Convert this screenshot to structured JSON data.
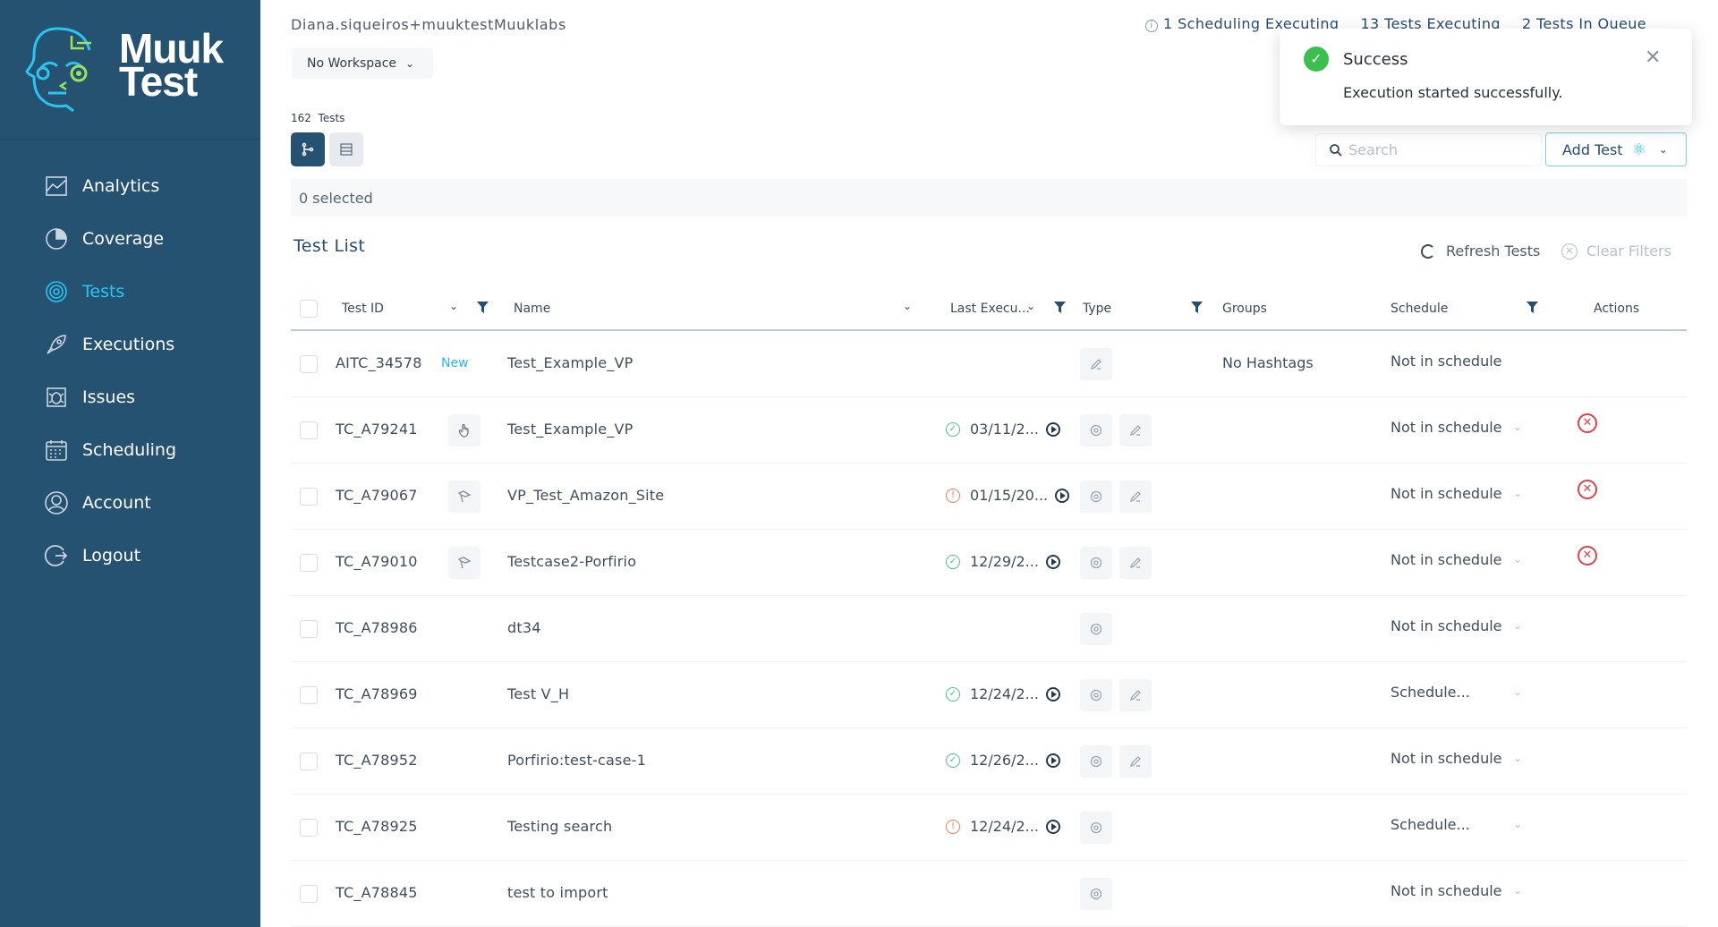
{
  "brand": {
    "line1": "Muuk",
    "line2": "Test"
  },
  "nav": [
    {
      "label": "Analytics",
      "icon": "analytics-icon"
    },
    {
      "label": "Coverage",
      "icon": "coverage-icon"
    },
    {
      "label": "Tests",
      "icon": "tests-icon",
      "active": true
    },
    {
      "label": "Executions",
      "icon": "rocket-icon"
    },
    {
      "label": "Issues",
      "icon": "bug-icon"
    },
    {
      "label": "Scheduling",
      "icon": "calendar-icon"
    },
    {
      "label": "Account",
      "icon": "user-icon"
    },
    {
      "label": "Logout",
      "icon": "logout-icon"
    }
  ],
  "header": {
    "user": "Diana.siqueiros+muuktestMuuklabs",
    "workspace": "No Workspace",
    "status": [
      "1 Scheduling Executing",
      "13 Tests Executing",
      "2 Tests In Queue"
    ]
  },
  "tests": {
    "count": "162",
    "count_label": "Tests",
    "selected": "0 selected"
  },
  "search": {
    "placeholder": "Search"
  },
  "add_test": "Add Test",
  "list": {
    "title": "Test List",
    "refresh": "Refresh Tests",
    "clear": "Clear Filters"
  },
  "columns": {
    "test_id": "Test ID",
    "name": "Name",
    "last_exec": "Last Execu...",
    "type": "Type",
    "groups": "Groups",
    "schedule": "Schedule",
    "actions": "Actions"
  },
  "rows": [
    {
      "id": "AITC_34578",
      "badge": "New",
      "name": "Test_Example_VP",
      "last_exec": "",
      "groups": "No Hashtags",
      "schedule": "Not in schedule"
    },
    {
      "id": "TC_A79241",
      "name": "Test_Example_VP",
      "last_exec": "03/11/2...",
      "status": "ok",
      "groups": "",
      "schedule": "Not in schedule"
    },
    {
      "id": "TC_A79067",
      "name": "VP_Test_Amazon_Site",
      "last_exec": "01/15/20...",
      "status": "warn",
      "groups": "",
      "schedule": "Not in schedule"
    },
    {
      "id": "TC_A79010",
      "name": "Testcase2-Porfirio",
      "last_exec": "12/29/2...",
      "status": "ok",
      "groups": "",
      "schedule": "Not in schedule"
    },
    {
      "id": "TC_A78986",
      "name": "dt34",
      "last_exec": "",
      "groups": "",
      "schedule": "Not in schedule"
    },
    {
      "id": "TC_A78969",
      "name": "Test V_H",
      "last_exec": "12/24/2...",
      "status": "ok",
      "groups": "",
      "schedule": "Schedule..."
    },
    {
      "id": "TC_A78952",
      "name": "Porfirio:test-case-1",
      "last_exec": "12/26/2...",
      "status": "ok",
      "groups": "",
      "schedule": "Not in schedule"
    },
    {
      "id": "TC_A78925",
      "name": "Testing search",
      "last_exec": "12/24/2...",
      "status": "warn",
      "groups": "",
      "schedule": "Schedule..."
    },
    {
      "id": "TC_A78845",
      "name": "test to import",
      "last_exec": "",
      "groups": "",
      "schedule": "Not in schedule"
    }
  ],
  "toast": {
    "title": "Success",
    "message": "Execution started successfully."
  },
  "colors": {
    "sidebar": "#265272",
    "accent": "#29c5f0",
    "success": "#3dbf4e",
    "danger": "#e0414c"
  }
}
